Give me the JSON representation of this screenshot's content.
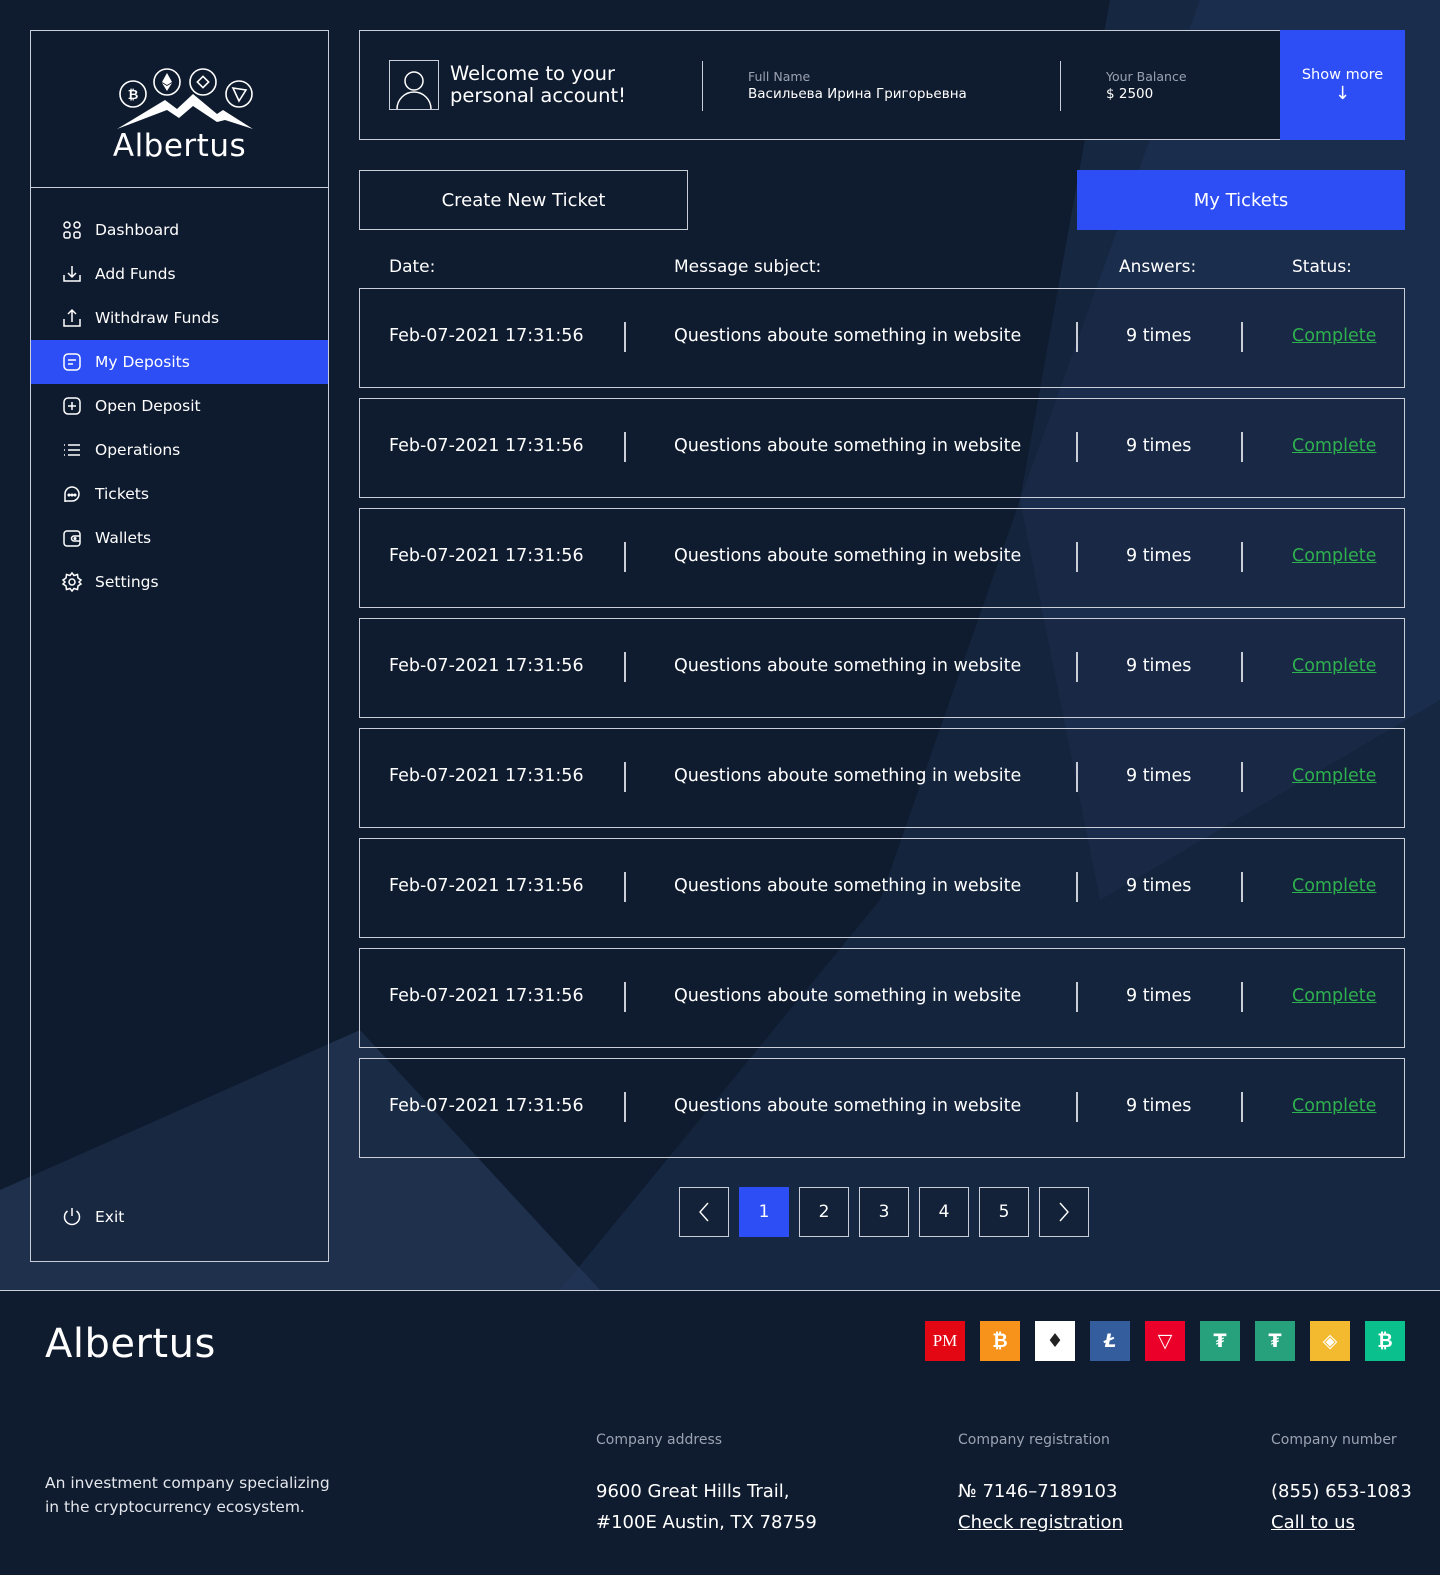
{
  "brand": {
    "name": "Albertus"
  },
  "sidebar": {
    "items": [
      {
        "label": "Dashboard",
        "icon": "dashboard-icon"
      },
      {
        "label": "Add Funds",
        "icon": "add-funds-icon"
      },
      {
        "label": "Withdraw Funds",
        "icon": "withdraw-icon"
      },
      {
        "label": "My Deposits",
        "icon": "deposits-icon",
        "active": true
      },
      {
        "label": "Open Deposit",
        "icon": "open-deposit-icon"
      },
      {
        "label": "Operations",
        "icon": "operations-icon"
      },
      {
        "label": "Tickets",
        "icon": "tickets-icon"
      },
      {
        "label": "Wallets",
        "icon": "wallet-icon"
      },
      {
        "label": "Settings",
        "icon": "gear-icon"
      }
    ],
    "exit_label": "Exit"
  },
  "header": {
    "welcome": "Welcome to your personal account!",
    "full_name_label": "Full Name",
    "full_name": "Васильева Ирина Григорьевна",
    "balance_label": "Your Balance",
    "balance": "$ 2500",
    "show_more": "Show more",
    "show_more_arrow": "↓"
  },
  "actions": {
    "create_ticket": "Create New Ticket",
    "my_tickets": "My Tickets"
  },
  "table": {
    "headers": {
      "date": "Date:",
      "subject": "Message subject:",
      "answers": "Answers:",
      "status": "Status:"
    },
    "rows": [
      {
        "date": "Feb-07-2021 17:31:56",
        "subject": "Questions aboute something in website",
        "answers": "9 times",
        "status": "Complete"
      },
      {
        "date": "Feb-07-2021 17:31:56",
        "subject": "Questions aboute something in website",
        "answers": "9 times",
        "status": "Complete"
      },
      {
        "date": "Feb-07-2021 17:31:56",
        "subject": "Questions aboute something in website",
        "answers": "9 times",
        "status": "Complete"
      },
      {
        "date": "Feb-07-2021 17:31:56",
        "subject": "Questions aboute something in website",
        "answers": "9 times",
        "status": "Complete"
      },
      {
        "date": "Feb-07-2021 17:31:56",
        "subject": "Questions aboute something in website",
        "answers": "9 times",
        "status": "Complete"
      },
      {
        "date": "Feb-07-2021 17:31:56",
        "subject": "Questions aboute something in website",
        "answers": "9 times",
        "status": "Complete"
      },
      {
        "date": "Feb-07-2021 17:31:56",
        "subject": "Questions aboute something in website",
        "answers": "9 times",
        "status": "Complete"
      },
      {
        "date": "Feb-07-2021 17:31:56",
        "subject": "Questions aboute something in website",
        "answers": "9 times",
        "status": "Complete"
      }
    ],
    "status_color": "#2fb04f"
  },
  "pagination": {
    "pages": [
      "1",
      "2",
      "3",
      "4",
      "5"
    ],
    "current": "1",
    "prev": "‹",
    "next": "›"
  },
  "footer": {
    "brand": "Albertus",
    "tagline": "An investment company specializing in the cryptocurrency ecosystem.",
    "payment_methods": [
      {
        "name": "perfect-money-icon",
        "label": "PM",
        "color": "#e30613"
      },
      {
        "name": "bitcoin-icon",
        "label": "₿",
        "color": "#f7931a"
      },
      {
        "name": "ethereum-icon",
        "label": "♦",
        "color": "#ffffff"
      },
      {
        "name": "litecoin-icon",
        "label": "Ł",
        "color": "#345d9d"
      },
      {
        "name": "tron-icon",
        "label": "▽",
        "color": "#eb0029"
      },
      {
        "name": "tether-trc20-icon",
        "label": "₮",
        "color": "#26a17b"
      },
      {
        "name": "tether-erc20-icon",
        "label": "₮",
        "color": "#26a17b"
      },
      {
        "name": "binance-icon",
        "label": "◈",
        "color": "#f3ba2f"
      },
      {
        "name": "bitcoin-cash-icon",
        "label": "₿",
        "color": "#0ac18e"
      }
    ],
    "address_label": "Company address",
    "address_line1": "9600 Great Hills Trail,",
    "address_line2": "#100E Austin, TX 78759",
    "registration_label": "Company registration",
    "registration_number": "№ 7146–7189103",
    "registration_link": "Check registration",
    "number_label": "Company number",
    "phone": "(855) 653-1083",
    "call_link": "Call to us"
  },
  "colors": {
    "accent": "#2d4ef5",
    "background": "#0f1b2e",
    "border": "#c9ced8",
    "status": "#2fb04f"
  }
}
